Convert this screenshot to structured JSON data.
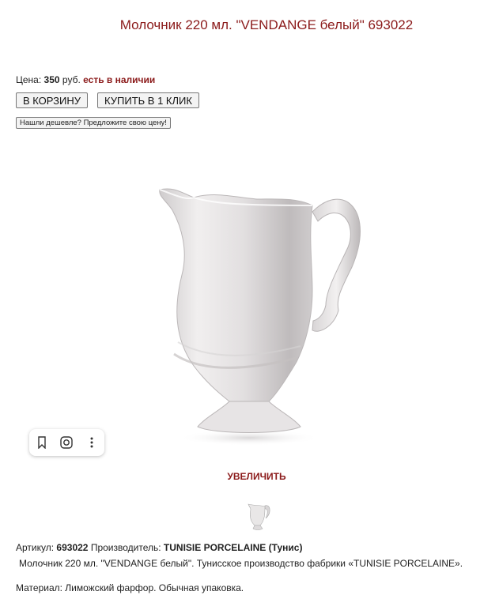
{
  "product": {
    "title": "Молочник 220 мл. \"VENDANGE белый\" 693022"
  },
  "price": {
    "label": "Цена:",
    "value": "350",
    "currency": "руб.",
    "availability": "есть в наличии"
  },
  "buttons": {
    "cart": "В КОРЗИНУ",
    "one_click": "КУПИТЬ В 1 КЛИК",
    "cheaper": "Нашли дешевле? Предложите свою цену!"
  },
  "image_toolbar": {
    "icons": [
      "bookmark-icon",
      "lens-search-icon",
      "more-vertical-icon"
    ]
  },
  "zoom": {
    "label": "УВЕЛИЧИТЬ"
  },
  "details": {
    "article_label": "Артикул:",
    "article_value": "693022",
    "manufacturer_label": "Производитель:",
    "manufacturer_value": "TUNISIE PORCELAINE (Тунис)",
    "description": "Молочник 220 мл. \"VENDANGE белый\". Тунисское производство фабрики «TUNISIE PORCELAINE».",
    "material": "Материал: Лиможский фарфор. Обычная упаковка."
  },
  "colors": {
    "accent": "#8b1a1a",
    "text": "#222222",
    "button_bg": "#f3f3f3"
  }
}
